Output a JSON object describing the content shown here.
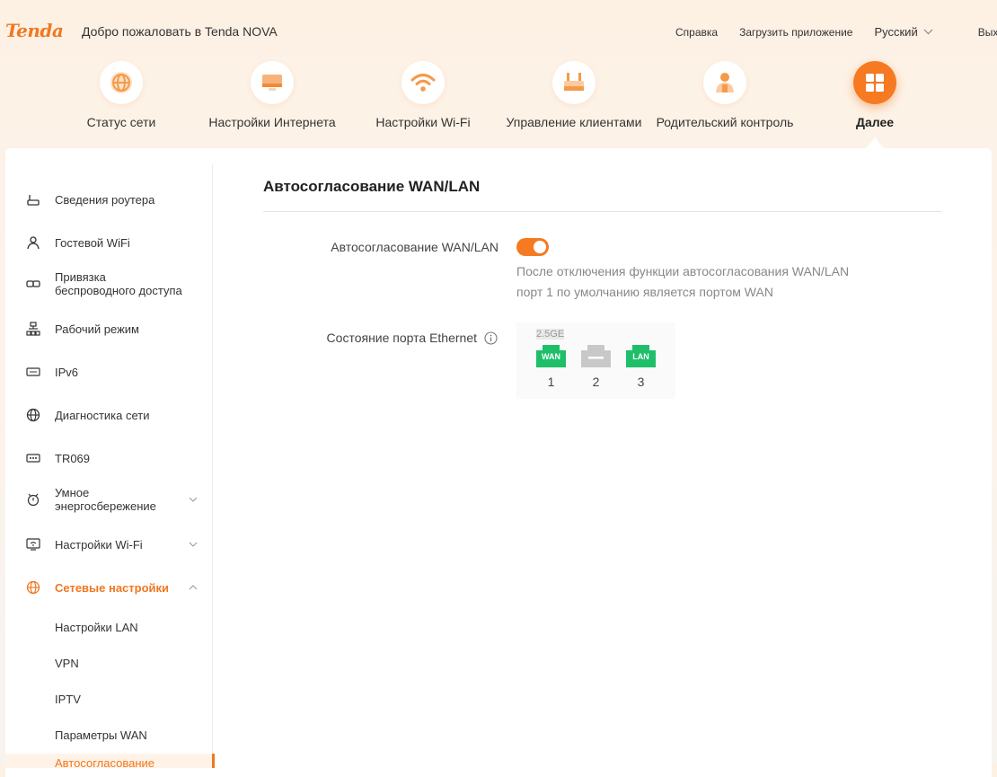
{
  "header": {
    "logo": "Tenda",
    "welcome": "Добро пожаловать в Tenda NOVA",
    "links": {
      "help": "Справка",
      "download_app": "Загрузить приложение",
      "language": "Русский",
      "logout": "Выход"
    }
  },
  "nav": {
    "items": [
      {
        "label": "Статус сети",
        "icon": "globe-icon"
      },
      {
        "label": "Настройки Интернета",
        "icon": "monitor-icon"
      },
      {
        "label": "Настройки Wi-Fi",
        "icon": "wifi-icon"
      },
      {
        "label": "Управление клиентами",
        "icon": "router-icon"
      },
      {
        "label": "Родительский контроль",
        "icon": "parent-icon"
      },
      {
        "label": "Далее",
        "icon": "grid-icon",
        "active": true
      }
    ]
  },
  "sidebar": {
    "items": [
      {
        "label": "Сведения роутера",
        "icon": "router-info-icon"
      },
      {
        "label": "Гостевой WiFi",
        "icon": "guest-icon"
      },
      {
        "label": "Привязка беспроводного доступа",
        "icon": "link-icon"
      },
      {
        "label": "Рабочий режим",
        "icon": "topology-icon"
      },
      {
        "label": "IPv6",
        "icon": "ipv6-icon"
      },
      {
        "label": "Диагностика сети",
        "icon": "globe-icon"
      },
      {
        "label": "TR069",
        "icon": "tr069-icon"
      },
      {
        "label": "Умное энергосбережение",
        "icon": "alarm-icon",
        "expandable": true
      },
      {
        "label": "Настройки Wi-Fi",
        "icon": "wifi-settings-icon",
        "expandable": true
      },
      {
        "label": "Сетевые настройки",
        "icon": "globe-icon",
        "expandable": true,
        "expanded": true,
        "active": true
      }
    ],
    "subitems": [
      {
        "label": "Настройки LAN"
      },
      {
        "label": "VPN"
      },
      {
        "label": "IPTV"
      },
      {
        "label": "Параметры WAN"
      },
      {
        "label": "Автосогласование",
        "active": true
      }
    ]
  },
  "content": {
    "title": "Автосогласование WAN/LAN",
    "autoneg_label": "Автосогласование WAN/LAN",
    "autoneg_enabled": true,
    "hint_line1": "После отключения функции автосогласования WAN/LAN",
    "hint_line2": "порт 1 по умолчанию является портом WAN",
    "ethernet_label": "Состояние порта Ethernet",
    "ge_label": "2.5GE",
    "ports": [
      {
        "number": "1",
        "label": "WAN",
        "color": "#1fbf6a"
      },
      {
        "number": "2",
        "label": "",
        "color": "#c8c8c8"
      },
      {
        "number": "3",
        "label": "LAN",
        "color": "#1fbf6a"
      }
    ]
  },
  "colors": {
    "accent": "#f57a22",
    "port_active": "#1fbf6a",
    "port_inactive": "#c8c8c8"
  }
}
